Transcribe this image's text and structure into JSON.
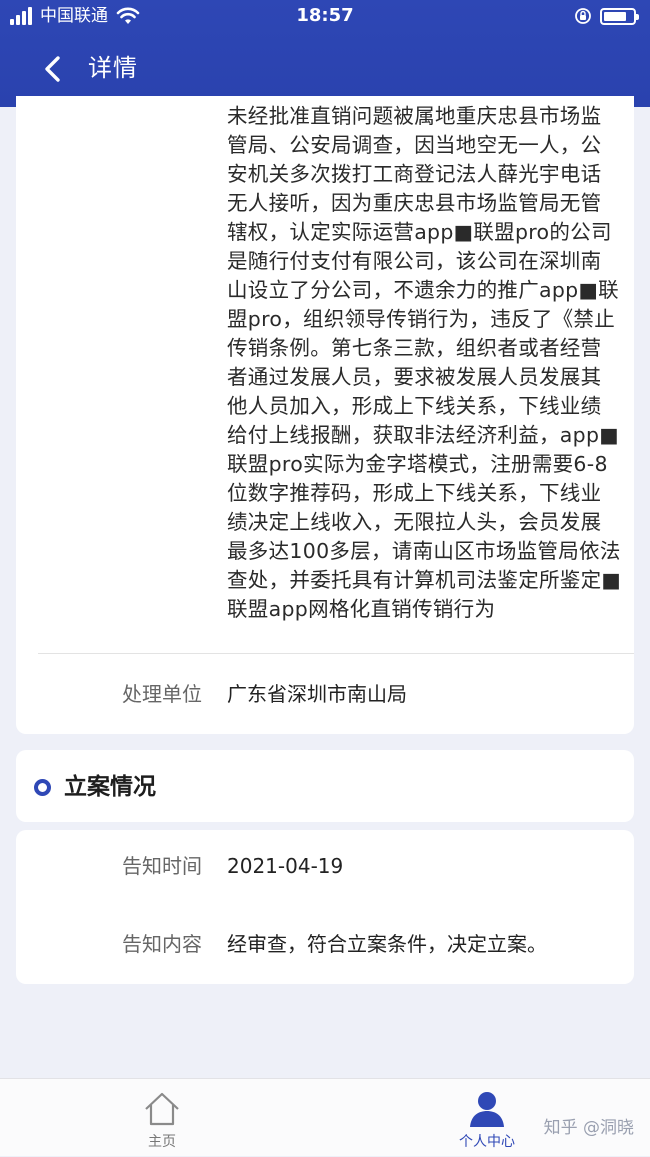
{
  "status_bar": {
    "carrier": "中国联通",
    "time": "18:57"
  },
  "nav": {
    "title": "详情"
  },
  "detail": {
    "body_text": "未经批准直销问题被属地重庆忠县市场监管局、公安局调查，因当地空无一人，公安机关多次拨打工商登记法人薛光宇电话无人接听，因为重庆忠县市场监管局无管辖权，认定实际运营app■联盟pro的公司是随行付支付有限公司，该公司在深圳南山设立了分公司，不遗余力的推广app■联盟pro，组织领导传销行为，违反了《禁止传销条例。第七条三款，组织者或者经营者通过发展人员，要求被发展人员发展其他人员加入，形成上下线关系，下线业绩给付上线报酬，获取非法经济利益，app■联盟pro实际为金字塔模式，注册需要6-8位数字推荐码，形成上下线关系，下线业绩决定上线收入，无限拉人头，会员发展最多达100多层，请南山区市场监管局依法查处，并委托具有计算机司法鉴定所鉴定■联盟app网格化直销传销行为",
    "handling_unit_label": "处理单位",
    "handling_unit_value": "广东省深圳市南山局"
  },
  "case_filing": {
    "section_title": "立案情况",
    "notice_time_label": "告知时间",
    "notice_time_value": "2021-04-19",
    "notice_content_label": "告知内容",
    "notice_content_value": "经审查，符合立案条件，决定立案。"
  },
  "tabs": [
    {
      "label": "主页",
      "icon": "home-icon",
      "active": false
    },
    {
      "label": "个人中心",
      "icon": "user-icon",
      "active": true
    }
  ],
  "watermark": "知乎 @洞晓",
  "colors": {
    "header": "#2e47b5",
    "accent": "#2f48b6",
    "background": "#eef0f8"
  }
}
